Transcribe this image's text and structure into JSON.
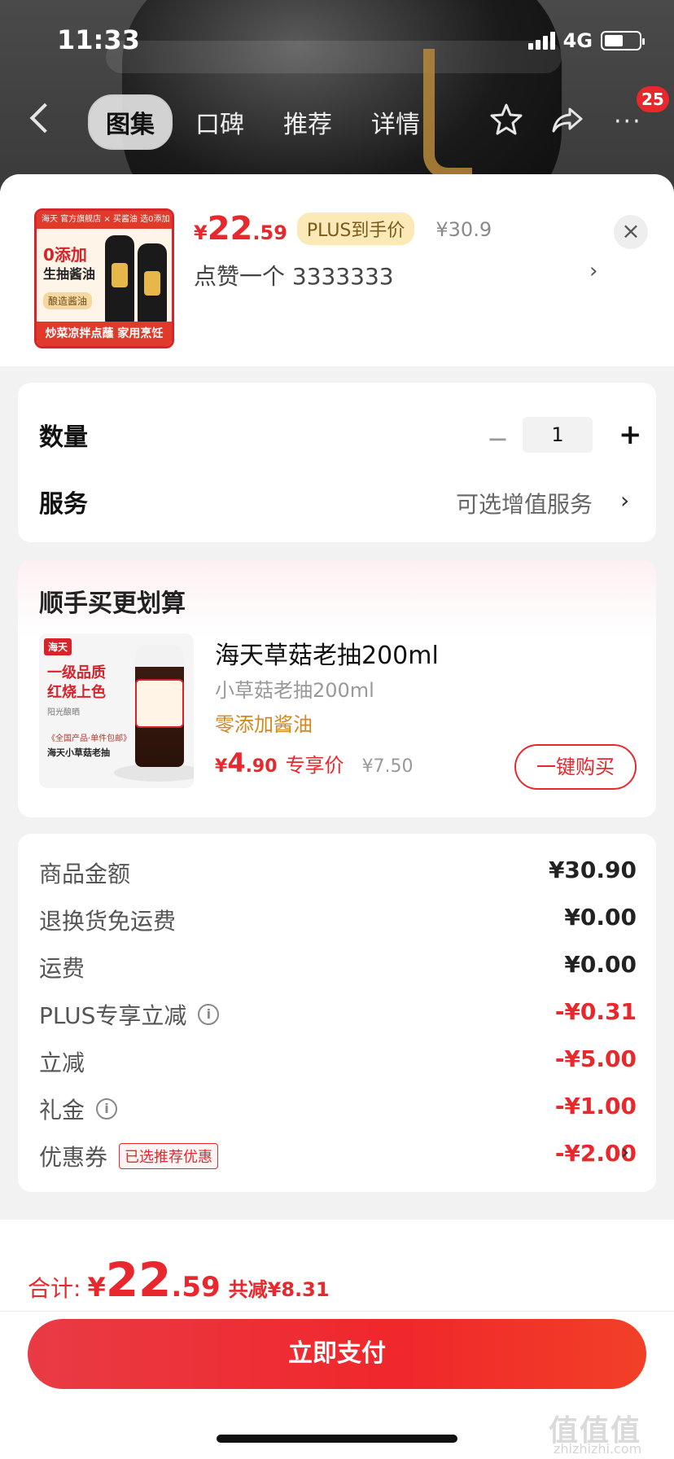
{
  "status_bar": {
    "time": "11:33",
    "network": "4G"
  },
  "nav": {
    "tabs": [
      "图集",
      "口碑",
      "推荐",
      "详情"
    ],
    "more_label": "···",
    "cart_badge": "25"
  },
  "product": {
    "thumb": {
      "top_strip": "海天 官方旗舰店 × 买酱油 选0添加",
      "headline": "0添加",
      "subline": "生抽酱油",
      "badge": "酿造酱油",
      "bottom_strip": "炒菜凉拌点蘸 家用烹饪"
    },
    "price_currency": "¥",
    "price_int": "22",
    "price_dec": ".59",
    "plus_label": "PLUS到手价",
    "original_price": "¥30.9",
    "like_text": "点赞一个  3333333",
    "like_chevron": "›",
    "close_label": "×"
  },
  "quantity": {
    "label": "数量",
    "minus": "−",
    "value": "1",
    "plus": "+"
  },
  "service": {
    "label": "服务",
    "value": "可选增值服务",
    "chevron": "›"
  },
  "addon": {
    "section_title": "顺手买更划算",
    "image": {
      "logo": "海天",
      "line1": "一级品质",
      "line2": "红烧上色",
      "line3": "阳光酿晒",
      "line4": "《全国产品·单件包邮》",
      "line5": "海天小草菇老抽"
    },
    "name": "海天草菇老抽200ml",
    "subtitle": "小草菇老抽200ml",
    "tag": "零添加酱油",
    "price_currency": "¥",
    "price_int": "4",
    "price_dec": ".90",
    "price_label": "专享价",
    "original_price": "¥7.50",
    "buy_button": "一键购买"
  },
  "summary": {
    "rows": [
      {
        "label": "商品金额",
        "value": "¥30.90"
      },
      {
        "label": "退换货免运费",
        "value": "¥0.00"
      },
      {
        "label": "运费",
        "value": "¥0.00"
      },
      {
        "label": "PLUS专享立减",
        "value": "-¥0.31"
      },
      {
        "label": "立减",
        "value": "-¥5.00"
      },
      {
        "label": "礼金",
        "value": "-¥1.00"
      },
      {
        "label": "优惠券",
        "value": "-¥2.00",
        "tag": "已选推荐优惠"
      }
    ],
    "info_glyph": "i",
    "chevron": "›"
  },
  "footer": {
    "total_label": "合计:",
    "total_currency": "¥",
    "total_int": "22",
    "total_dec": ".59",
    "total_saved": "共减¥8.31",
    "pay_button": "立即支付"
  },
  "watermark": {
    "text": "值值值",
    "sub": "zhizhizhi.com"
  },
  "colors": {
    "accent": "#e8282c",
    "plus_bg": "#fbe9b8",
    "addon_tag": "#d2871f"
  }
}
